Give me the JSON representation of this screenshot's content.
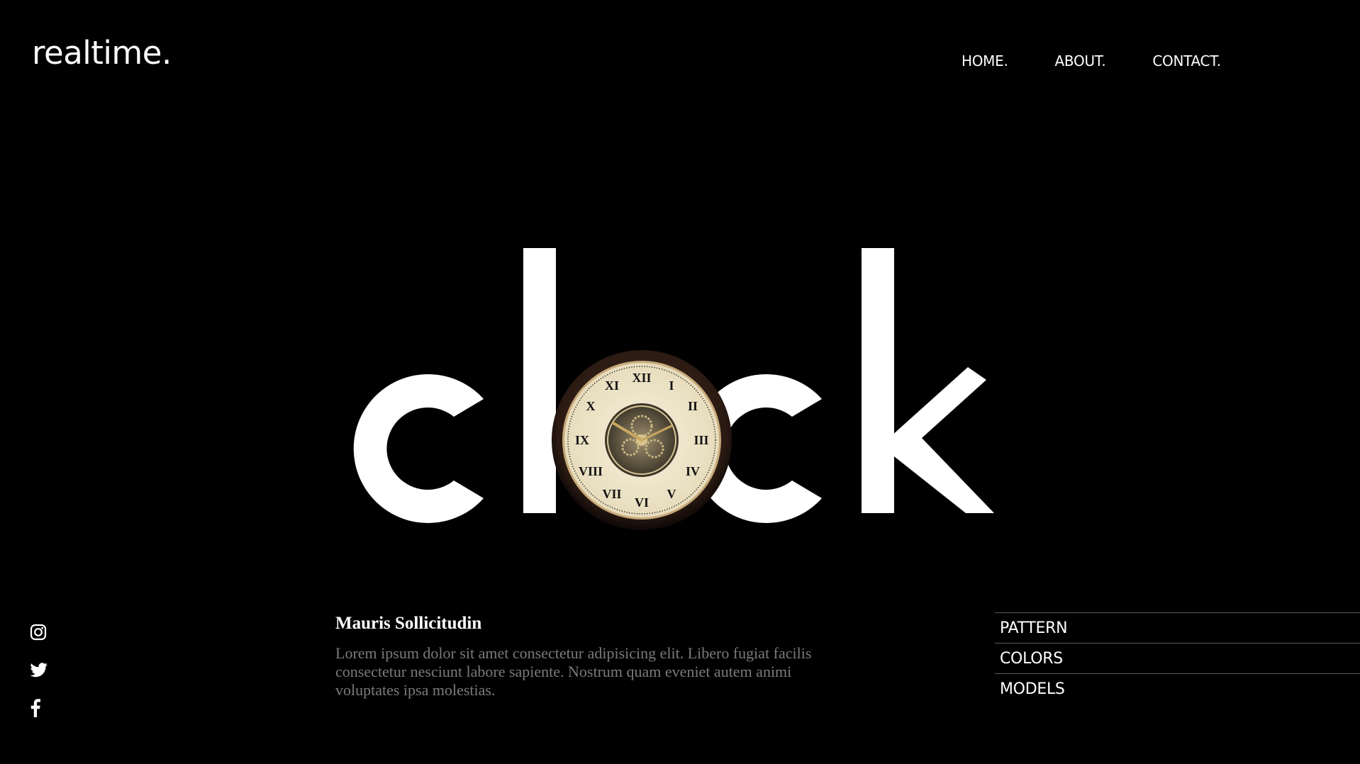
{
  "brand": {
    "logo": "realtime."
  },
  "nav": {
    "home": "HOME.",
    "about": "ABOUT.",
    "contact": "CONTACT."
  },
  "hero": {
    "word_left": "cl",
    "word_right": "ck",
    "color": "#ffffff"
  },
  "social": [
    {
      "icon": "instagram-icon"
    },
    {
      "icon": "twitter-icon"
    },
    {
      "icon": "facebook-icon"
    }
  ],
  "article": {
    "title": "Mauris Sollicitudin",
    "body": "Lorem ipsum dolor sit amet consectetur adipisicing elit. Libero fugiat facilis consectetur nesciunt labore sapiente. Nostrum quam eveniet autem animi voluptates ipsa molestias."
  },
  "side_menu": {
    "items": [
      "PATTERN",
      "COLORS",
      "MODELS"
    ]
  },
  "colors": {
    "background": "#000000",
    "text": "#ffffff",
    "muted": "#7a7a7a",
    "divider": "#5a5a5a"
  }
}
